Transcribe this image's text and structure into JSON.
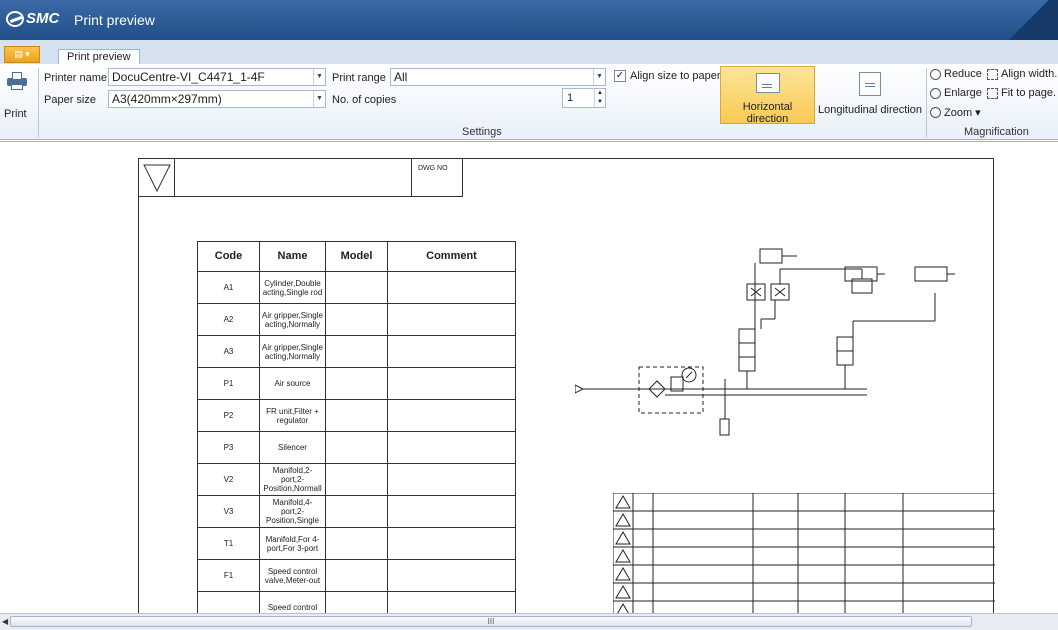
{
  "window": {
    "app": "SMC",
    "title": "Print preview"
  },
  "tabs": [
    {
      "label": "Print preview"
    }
  ],
  "ribbon": {
    "print_label": "Print",
    "printer_name_label": "Printer name",
    "printer_name_value": "DocuCentre-VI_C4471_1-4F",
    "paper_size_label": "Paper size",
    "paper_size_value": "A3(420mm×297mm)",
    "print_range_label": "Print range",
    "print_range_value": "All",
    "copies_label": "No. of copies",
    "copies_value": "1",
    "align_label": "Align size to paper.",
    "align_checked": true,
    "settings_group": "Settings",
    "horizontal_label": "Horizontal direction",
    "longitudinal_label": "Longitudinal direction",
    "reduce_label": "Reduce",
    "align_width_label": "Align width.",
    "enlarge_label": "Enlarge",
    "fit_label": "Fit to page.",
    "zoom_label": "Zoom ▾",
    "magnification_group": "Magnification"
  },
  "drawing": {
    "dwg_no_label": "DWG NO",
    "table_headers": [
      "Code",
      "Name",
      "Model",
      "Comment"
    ],
    "rows": [
      {
        "code": "A1",
        "name": "Cylinder,Double acting,Single rod"
      },
      {
        "code": "A2",
        "name": "Air gripper,Single acting,Normally"
      },
      {
        "code": "A3",
        "name": "Air gripper,Single acting,Normally"
      },
      {
        "code": "P1",
        "name": "Air source"
      },
      {
        "code": "P2",
        "name": "FR unit,Filter + regulator"
      },
      {
        "code": "P3",
        "name": "Silencer"
      },
      {
        "code": "V2",
        "name": "Manifold,2-port,2-Position,Normall"
      },
      {
        "code": "V3",
        "name": "Manifold,4-port,2-Position,Single"
      },
      {
        "code": "T1",
        "name": "Manifold,For 4-port,For 3-port"
      },
      {
        "code": "F1",
        "name": "Speed control valve,Meter-out"
      },
      {
        "code": "",
        "name": "Speed control"
      }
    ]
  },
  "scrollbar": {
    "thumb_label": "III"
  },
  "colors": {
    "title_bar": "#1f4e88",
    "active_button": "#f8c954",
    "ribbon": "#e9f0f9"
  }
}
